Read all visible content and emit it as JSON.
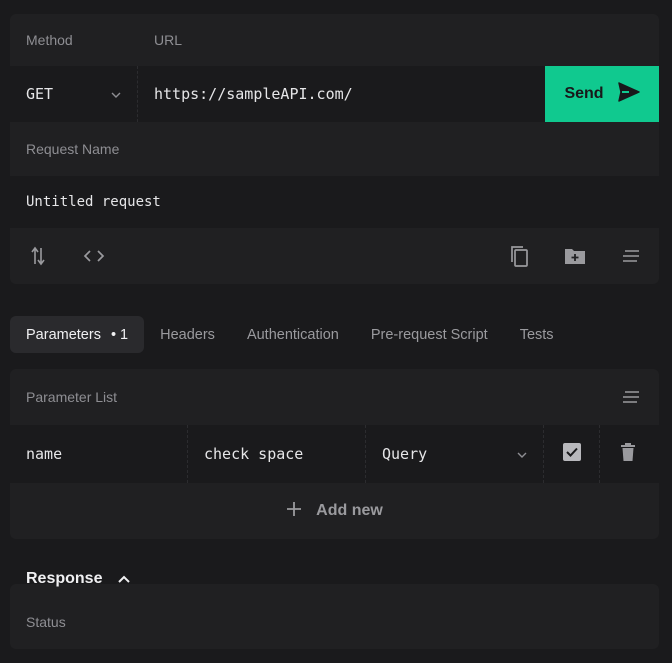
{
  "request": {
    "method_label": "Method",
    "url_label": "URL",
    "method": "GET",
    "url": "https://sampleAPI.com/",
    "send_label": "Send",
    "name_label": "Request Name",
    "name_value": "Untitled request"
  },
  "tabs": [
    {
      "label": "Parameters",
      "count": "•  1",
      "active": true
    },
    {
      "label": "Headers"
    },
    {
      "label": "Authentication"
    },
    {
      "label": "Pre-request Script"
    },
    {
      "label": "Tests"
    }
  ],
  "params": {
    "title": "Parameter List",
    "rows": [
      {
        "name": "name",
        "value": "check space",
        "type": "Query",
        "enabled": true
      }
    ],
    "add_label": "Add new"
  },
  "response": {
    "title": "Response",
    "status_label": "Status"
  },
  "colors": {
    "accent": "#10c98f",
    "background": "#1a1a1c",
    "card": "#202022"
  },
  "icons": [
    "chevron-down-icon",
    "send-icon",
    "swap-vertical-icon",
    "code-icon",
    "copy-icon",
    "folder-add-icon",
    "wrap-lines-icon",
    "checkbox-checked-icon",
    "trash-icon",
    "plus-icon",
    "chevron-up-icon"
  ]
}
